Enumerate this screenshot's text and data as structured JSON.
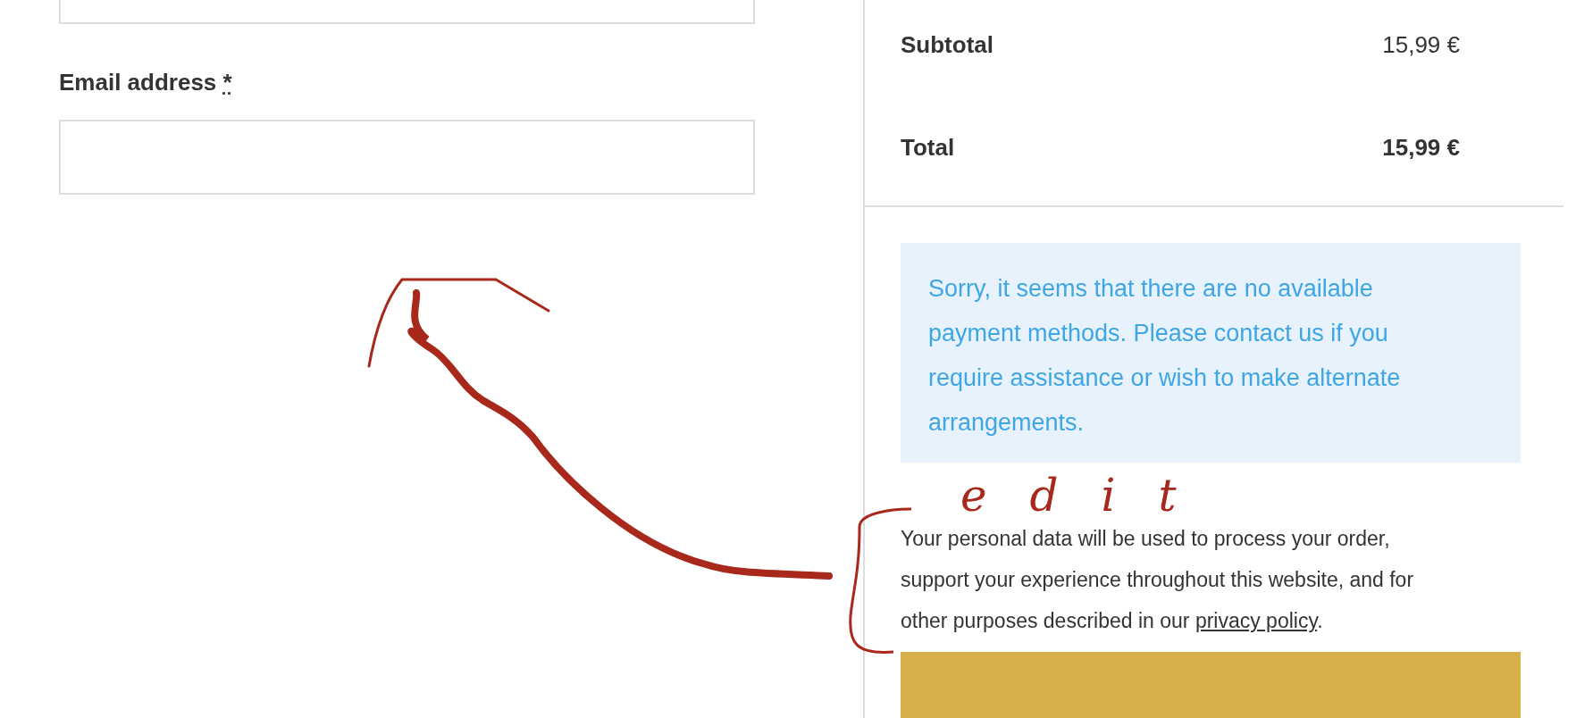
{
  "billing_fields": [
    {
      "kind": "cut"
    },
    {
      "kind": "full",
      "label": "Email address",
      "required_mark": "*"
    }
  ],
  "order_totals": [
    {
      "kind": "subtotal",
      "label": "Subtotal",
      "value": "15,99 €"
    },
    {
      "kind": "total",
      "label": "Total",
      "value": "15,99 €"
    }
  ],
  "notice": {
    "kind": "info",
    "text": "Sorry, it seems that there are no available payment methods. Please contact us if you require assistance or wish to make alternate arrangements."
  },
  "privacy": {
    "text_before": "Your personal data will be used to process your order, support your experience throughout this website, and for other purposes described in our ",
    "link": "privacy policy",
    "text_after": "."
  },
  "place_order_button": {
    "visible": true
  },
  "annotation": {
    "note": "edit",
    "arrow": true,
    "bracket": true
  }
}
